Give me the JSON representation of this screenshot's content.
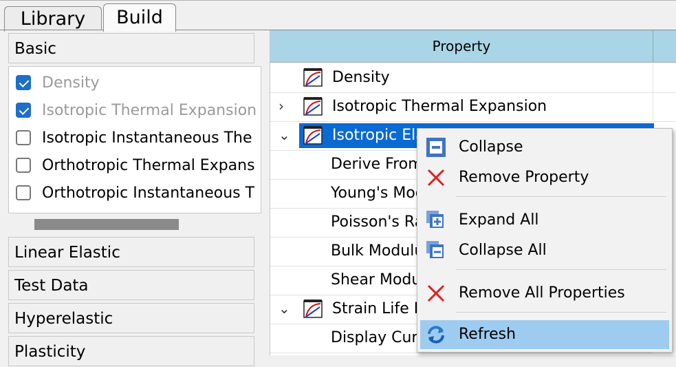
{
  "tabs": [
    "Library",
    "Build"
  ],
  "left": {
    "categories_top": "Basic",
    "items": [
      {
        "label": "Density",
        "checked": true,
        "disabled": true
      },
      {
        "label": "Isotropic Thermal Expansion",
        "checked": true,
        "disabled": true
      },
      {
        "label": "Isotropic Instantaneous The",
        "checked": false,
        "disabled": false
      },
      {
        "label": "Orthotropic Thermal Expans",
        "checked": false,
        "disabled": false
      },
      {
        "label": "Orthotropic Instantaneous T",
        "checked": false,
        "disabled": false
      }
    ],
    "categories": [
      "Linear Elastic",
      "Test Data",
      "Hyperelastic",
      "Plasticity"
    ]
  },
  "tree": {
    "header": "Property",
    "rows": [
      {
        "label": "Density",
        "icon": "property-curve-icon",
        "expander": ""
      },
      {
        "label": "Isotropic Thermal Expansion",
        "icon": "property-curve-icon",
        "expander": ">"
      },
      {
        "label": "Isotropic Ela",
        "icon": "property-curve-icon",
        "expander": "v"
      },
      {
        "label": "Derive From"
      },
      {
        "label": "Young's Mod"
      },
      {
        "label": "Poisson's Ra"
      },
      {
        "label": "Bulk Modulu"
      },
      {
        "label": "Shear Modu"
      },
      {
        "label": "Strain Life P",
        "icon": "property-curve-icon",
        "expander": "v"
      },
      {
        "label": "Display Curv"
      }
    ]
  },
  "menu": {
    "items": [
      {
        "label": "Collapse",
        "icon": "collapse-icon"
      },
      {
        "label": "Remove Property",
        "icon": "remove-x-icon"
      },
      {
        "label": "Expand All",
        "icon": "expand-all-icon"
      },
      {
        "label": "Collapse All",
        "icon": "collapse-all-icon"
      },
      {
        "label": "Remove All Properties",
        "icon": "remove-x-icon"
      },
      {
        "label": "Refresh",
        "icon": "refresh-icon"
      }
    ]
  },
  "colors": {
    "accent": "#0a6ad4",
    "header": "#a9d5e6",
    "menu_highlight": "#9ecbf0",
    "remove_red": "#e02020"
  }
}
